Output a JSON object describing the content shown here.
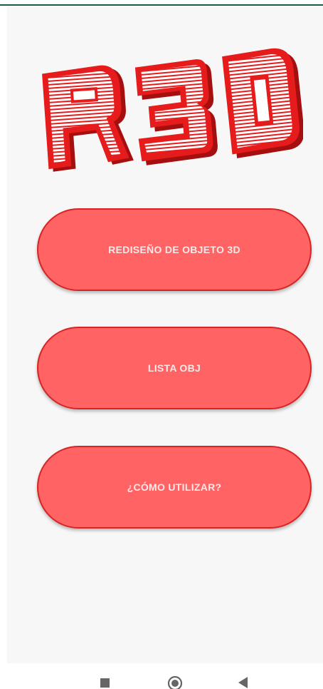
{
  "logo": {
    "text": "R3D",
    "letters": [
      "R",
      "3",
      "D"
    ],
    "colors": {
      "red": "#e61b1b",
      "dark_red": "#a50f0f",
      "white": "#ffffff"
    }
  },
  "menu": {
    "buttons": [
      {
        "label": "REDISEÑO DE OBJETO 3D"
      },
      {
        "label": "LISTA OBJ"
      },
      {
        "label": "¿CÓMO UTILIZAR?"
      }
    ],
    "colors": {
      "fill": "#ff6363",
      "border": "#d82424",
      "text": "#ffe8e8"
    }
  },
  "nav_bar": {
    "icons": [
      "recent-apps-icon",
      "home-icon",
      "back-icon"
    ]
  }
}
